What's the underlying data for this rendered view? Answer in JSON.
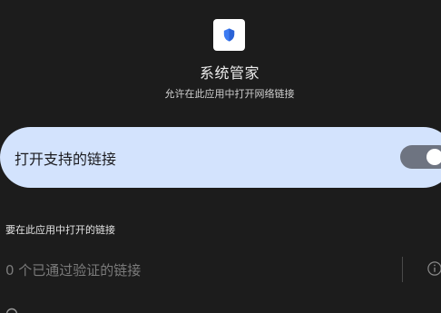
{
  "header": {
    "app_icon": "shield-icon",
    "title": "系统管家",
    "subtitle": "允许在此应用中打开网络链接"
  },
  "toggle_card": {
    "label": "打开支持的链接",
    "switch_on": true,
    "accent_color": "#d3e3fd",
    "track_color": "#6e7481"
  },
  "links_section": {
    "header": "要在此应用中打开的链接",
    "verified_links_text": "0 个已通过验证的链接",
    "info_icon": "info-icon"
  },
  "colors": {
    "background": "#1c1c1c",
    "shield_blue": "#3d7bf2"
  }
}
